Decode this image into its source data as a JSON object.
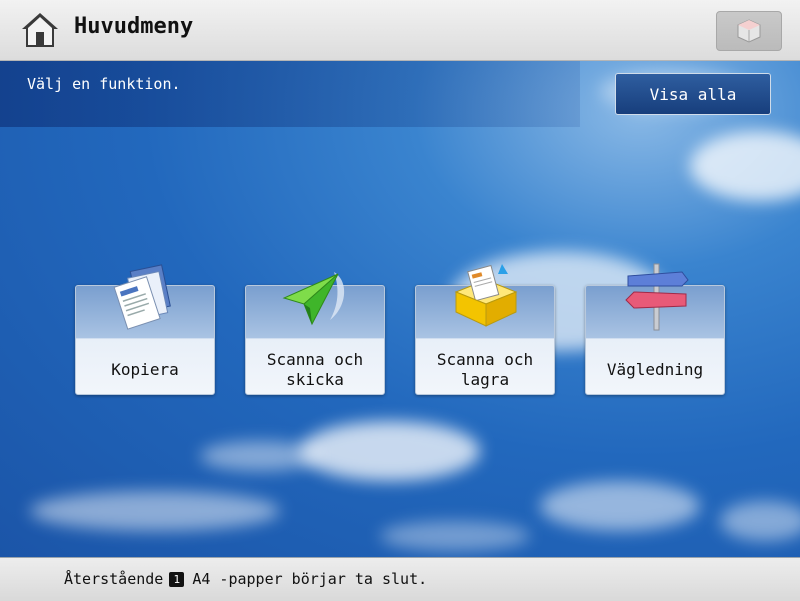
{
  "header": {
    "title": "Huvudmeny"
  },
  "main": {
    "prompt": "Välj en funktion.",
    "show_all_label": "Visa alla",
    "functions": [
      {
        "label": "Kopiera",
        "icon": "copy-icon"
      },
      {
        "label": "Scanna och\nskicka",
        "icon": "send-icon"
      },
      {
        "label": "Scanna och\nlagra",
        "icon": "store-icon"
      },
      {
        "label": "Vägledning",
        "icon": "guide-icon"
      }
    ]
  },
  "footer": {
    "status_prefix": "Återstående",
    "tray_number": "1",
    "status_suffix": "A4 -papper börjar ta slut."
  }
}
